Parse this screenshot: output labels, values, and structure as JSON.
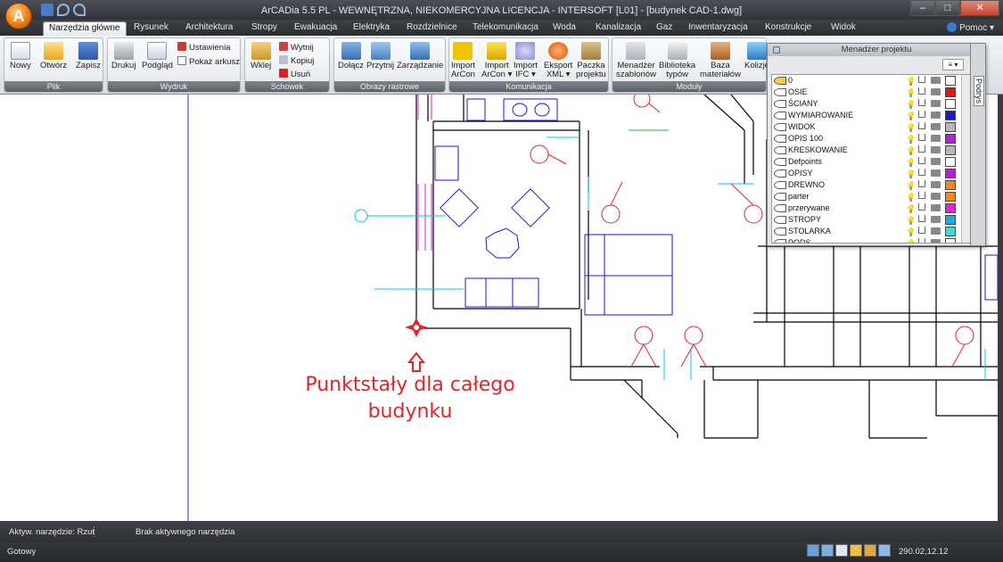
{
  "window": {
    "title": "ArCADia 5.5 PL - WEWNĘTRZNA, NIEKOMERCYJNA LICENCJA - INTERSOFT [L01] - [budynek CAD-1.dwg]",
    "controls": [
      "–",
      "□",
      "✕"
    ]
  },
  "app_orb_label": "A",
  "tabs": [
    {
      "label": "Narzędzia główne",
      "active": true
    },
    {
      "label": "Rysunek"
    },
    {
      "label": "Architektura"
    },
    {
      "label": "Stropy"
    },
    {
      "label": "Ewakuacja"
    },
    {
      "label": "Elektryka"
    },
    {
      "label": "Rozdzielnice"
    },
    {
      "label": "Telekomunikacja"
    },
    {
      "label": "Woda"
    },
    {
      "label": "Kanalizacja"
    },
    {
      "label": "Gaz"
    },
    {
      "label": "Inwentaryzacja"
    },
    {
      "label": "Konstrukcje"
    },
    {
      "label": "Widok"
    }
  ],
  "help_label": "Pomoc ▾",
  "ribbon": {
    "plik": {
      "label": "Plik",
      "buttons": [
        "Nowy",
        "Otwórz",
        "Zapisz"
      ]
    },
    "wydruk": {
      "label": "Wydruk",
      "buttons": [
        "Drukuj",
        "Podgląd"
      ],
      "small": [
        "Ustawienia",
        "Pokaż arkusz"
      ]
    },
    "schowek": {
      "label": "Schowek",
      "buttons": [
        "Wklej"
      ],
      "small": [
        "Wytnij",
        "Kopiuj",
        "Usuń"
      ]
    },
    "obrazy": {
      "label": "Obrazy rastrowe",
      "buttons": [
        "Dołącz",
        "Przytnij",
        "Zarządzanie"
      ]
    },
    "komunikacja": {
      "label": "Komunikacja",
      "buttons": [
        {
          "l1": "Import",
          "l2": "ArCon"
        },
        {
          "l1": "Import",
          "l2": "ArCon ▾"
        },
        {
          "l1": "Import",
          "l2": "IFC ▾"
        },
        {
          "l1": "Eksport",
          "l2": "XML ▾"
        },
        {
          "l1": "Paczka",
          "l2": "projektu"
        }
      ]
    },
    "moduly": {
      "label": "Moduły",
      "buttons": [
        {
          "l1": "Menadżer",
          "l2": "szablonów"
        },
        {
          "l1": "Biblioteka",
          "l2": "typów"
        },
        {
          "l1": "Baza",
          "l2": "materiałów"
        },
        {
          "l1": "Kolizje",
          "l2": ""
        }
      ]
    }
  },
  "project_manager": {
    "title": "Menadżer projektu",
    "side_tab": "Podrys",
    "filter": "≡ ▾",
    "layers": [
      {
        "name": "0",
        "color": "#ffffff"
      },
      {
        "name": "OSIE",
        "color": "#ee1111"
      },
      {
        "name": "ŚCIANY",
        "color": "#ffffff"
      },
      {
        "name": "WYMIAROWANIE",
        "color": "#1a1acc"
      },
      {
        "name": "WIDOK",
        "color": "#b8b8b8"
      },
      {
        "name": "OPIS 100",
        "color": "#b522d6"
      },
      {
        "name": "KRESKOWANIE",
        "color": "#b8b8b8"
      },
      {
        "name": "Defpoints",
        "color": "#ffffff"
      },
      {
        "name": "OPISY",
        "color": "#b522d6"
      },
      {
        "name": "DREWNO",
        "color": "#f08a1a"
      },
      {
        "name": "parter",
        "color": "#f08a1a"
      },
      {
        "name": "przerywane",
        "color": "#ee22cc"
      },
      {
        "name": "STROPY",
        "color": "#22aadd"
      },
      {
        "name": "STOLARKA",
        "color": "#33dddd"
      },
      {
        "name": "PODS",
        "color": "#ffffff"
      }
    ]
  },
  "canvas": {
    "annotation_line1": "Punktstały dla całego",
    "annotation_line2": "budynku",
    "colors": {
      "wall": "#000000",
      "furniture": "#1a1acc",
      "symbol": "#e0262b",
      "axis": "#00c8d8",
      "opening": "#cc22cc",
      "annotation": "#e0262b"
    }
  },
  "status": {
    "active_tool_label": "Aktyw. narzędzie: Rzut",
    "no_tool": "Brak aktywnego narzędzia",
    "ready": "Gotowy",
    "coords": "290.02,12.12"
  }
}
